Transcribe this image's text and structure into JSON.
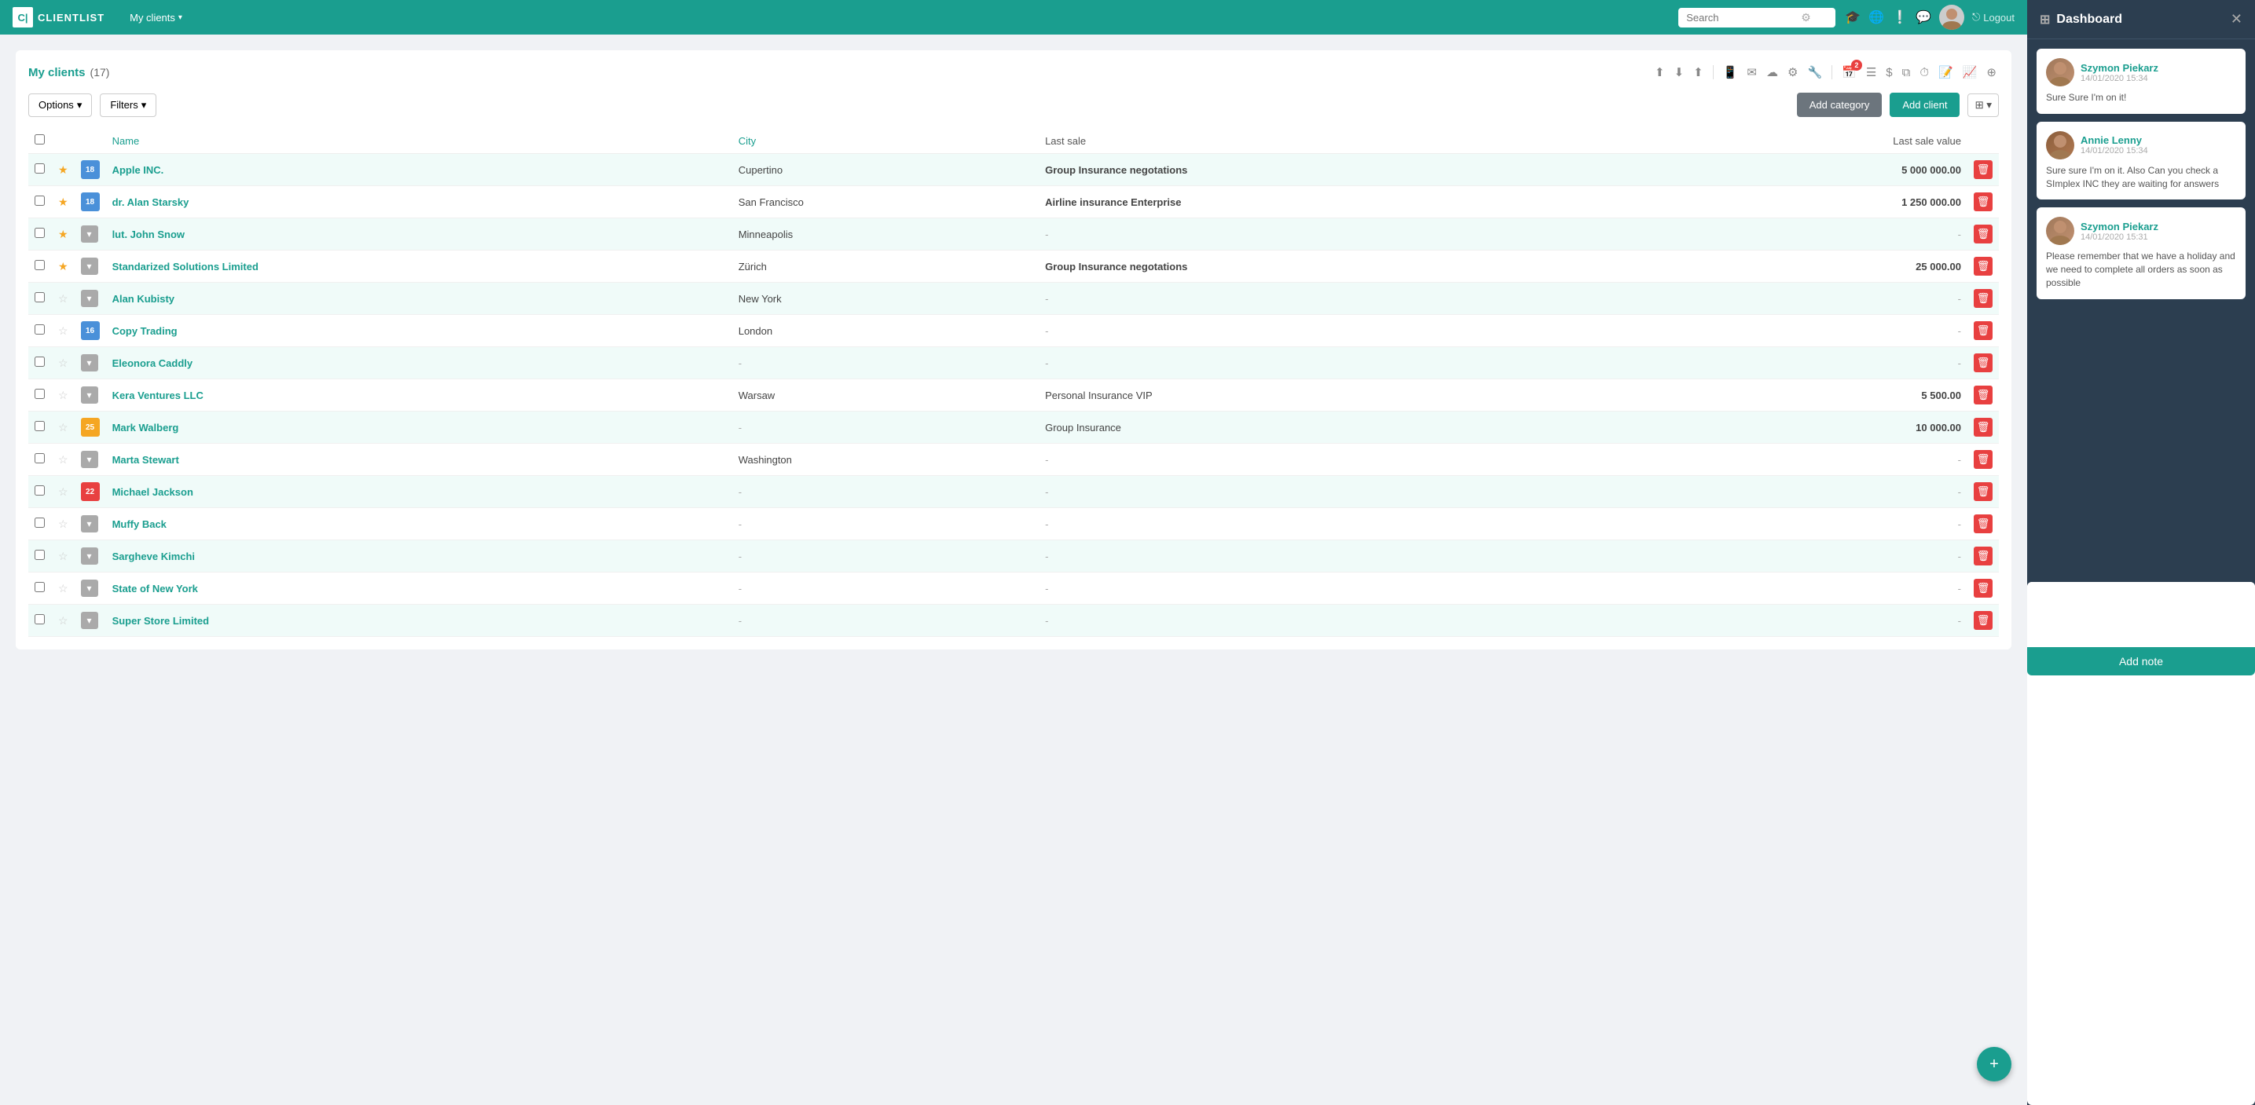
{
  "brand": {
    "icon": "C|",
    "name": "CLIENTLIST"
  },
  "nav": {
    "my_clients": "My clients",
    "search_placeholder": "Search",
    "logout": "Logout"
  },
  "clients_panel": {
    "title": "My clients",
    "count": "(17)",
    "options_label": "Options",
    "filters_label": "Filters",
    "add_category_label": "Add category",
    "add_client_label": "Add client",
    "columns": {
      "name": "Name",
      "city": "City",
      "last_sale": "Last sale",
      "last_sale_value": "Last sale value"
    },
    "clients": [
      {
        "id": 1,
        "star": true,
        "calendar": "18",
        "calendar_color": "badge-blue",
        "name": "Apple INC.",
        "city": "Cupertino",
        "last_sale": "Group Insurance negotations",
        "last_sale_bold": true,
        "last_sale_value": "5 000 000.00",
        "has_value": true
      },
      {
        "id": 2,
        "star": true,
        "calendar": "18",
        "calendar_color": "badge-blue",
        "name": "dr. Alan Starsky",
        "city": "San Francisco",
        "last_sale": "Airline insurance Enterprise",
        "last_sale_bold": true,
        "last_sale_value": "1 250 000.00",
        "has_value": true
      },
      {
        "id": 3,
        "star": true,
        "calendar_arrow": true,
        "name": "lut. John Snow",
        "city": "Minneapolis",
        "last_sale": "-",
        "last_sale_bold": false,
        "last_sale_value": "-",
        "has_value": false
      },
      {
        "id": 4,
        "star": true,
        "calendar_arrow": true,
        "name": "Standarized Solutions Limited",
        "city": "Zürich",
        "last_sale": "Group Insurance negotations",
        "last_sale_bold": true,
        "last_sale_value": "25 000.00",
        "has_value": true
      },
      {
        "id": 5,
        "star": false,
        "calendar_arrow": true,
        "name": "Alan Kubisty",
        "city": "New York",
        "last_sale": "-",
        "last_sale_bold": false,
        "last_sale_value": "-",
        "has_value": false
      },
      {
        "id": 6,
        "star": false,
        "calendar": "16",
        "calendar_color": "badge-blue",
        "name": "Copy Trading",
        "city": "London",
        "last_sale": "-",
        "last_sale_bold": false,
        "last_sale_value": "-",
        "has_value": false
      },
      {
        "id": 7,
        "star": false,
        "calendar_arrow": true,
        "name": "Eleonora Caddly",
        "city": "-",
        "last_sale": "-",
        "last_sale_bold": false,
        "last_sale_value": "-",
        "has_value": false
      },
      {
        "id": 8,
        "star": false,
        "calendar_arrow": true,
        "name": "Kera Ventures LLC",
        "city": "Warsaw",
        "last_sale": "Personal Insurance VIP",
        "last_sale_bold": false,
        "last_sale_value": "5 500.00",
        "has_value": true
      },
      {
        "id": 9,
        "star": false,
        "calendar": "25",
        "calendar_color": "badge-orange",
        "name": "Mark Walberg",
        "city": "-",
        "last_sale": "Group Insurance",
        "last_sale_bold": false,
        "last_sale_value": "10 000.00",
        "has_value": true
      },
      {
        "id": 10,
        "star": false,
        "calendar_arrow": true,
        "name": "Marta Stewart",
        "city": "Washington",
        "last_sale": "-",
        "last_sale_bold": false,
        "last_sale_value": "-",
        "has_value": false
      },
      {
        "id": 11,
        "star": false,
        "calendar": "22",
        "calendar_color": "badge-red",
        "name": "Michael Jackson",
        "city": "-",
        "last_sale": "-",
        "last_sale_bold": false,
        "last_sale_value": "-",
        "has_value": false
      },
      {
        "id": 12,
        "star": false,
        "calendar_arrow": true,
        "name": "Muffy Back",
        "city": "-",
        "last_sale": "-",
        "last_sale_bold": false,
        "last_sale_value": "-",
        "has_value": false
      },
      {
        "id": 13,
        "star": false,
        "calendar_arrow": true,
        "name": "Sargheve Kimchi",
        "city": "-",
        "last_sale": "-",
        "last_sale_bold": false,
        "last_sale_value": "-",
        "has_value": false
      },
      {
        "id": 14,
        "star": false,
        "calendar_arrow": true,
        "name": "State of New York",
        "city": "-",
        "last_sale": "-",
        "last_sale_bold": false,
        "last_sale_value": "-",
        "has_value": false
      },
      {
        "id": 15,
        "star": false,
        "calendar_arrow": true,
        "name": "Super Store Limited",
        "city": "-",
        "last_sale": "-",
        "last_sale_bold": false,
        "last_sale_value": "-",
        "has_value": false
      }
    ]
  },
  "dashboard": {
    "title": "Dashboard",
    "messages": [
      {
        "id": 1,
        "sender": "Szymon Piekarz",
        "time": "14/01/2020 15:34",
        "text": "Sure Sure I'm on it!",
        "avatar_class": "avatar-szymon"
      },
      {
        "id": 2,
        "sender": "Annie Lenny",
        "time": "14/01/2020 15:34",
        "text": "Sure sure I'm on it. Also Can you check a SImplex INC they are waiting for answers",
        "avatar_class": "avatar-annie"
      },
      {
        "id": 3,
        "sender": "Szymon Piekarz",
        "time": "14/01/2020 15:31",
        "text": "Please remember that we have a holiday and we need to complete all orders as soon as possible",
        "avatar_class": "avatar-szymon"
      }
    ],
    "add_note_label": "Add note",
    "note_placeholder": ""
  }
}
